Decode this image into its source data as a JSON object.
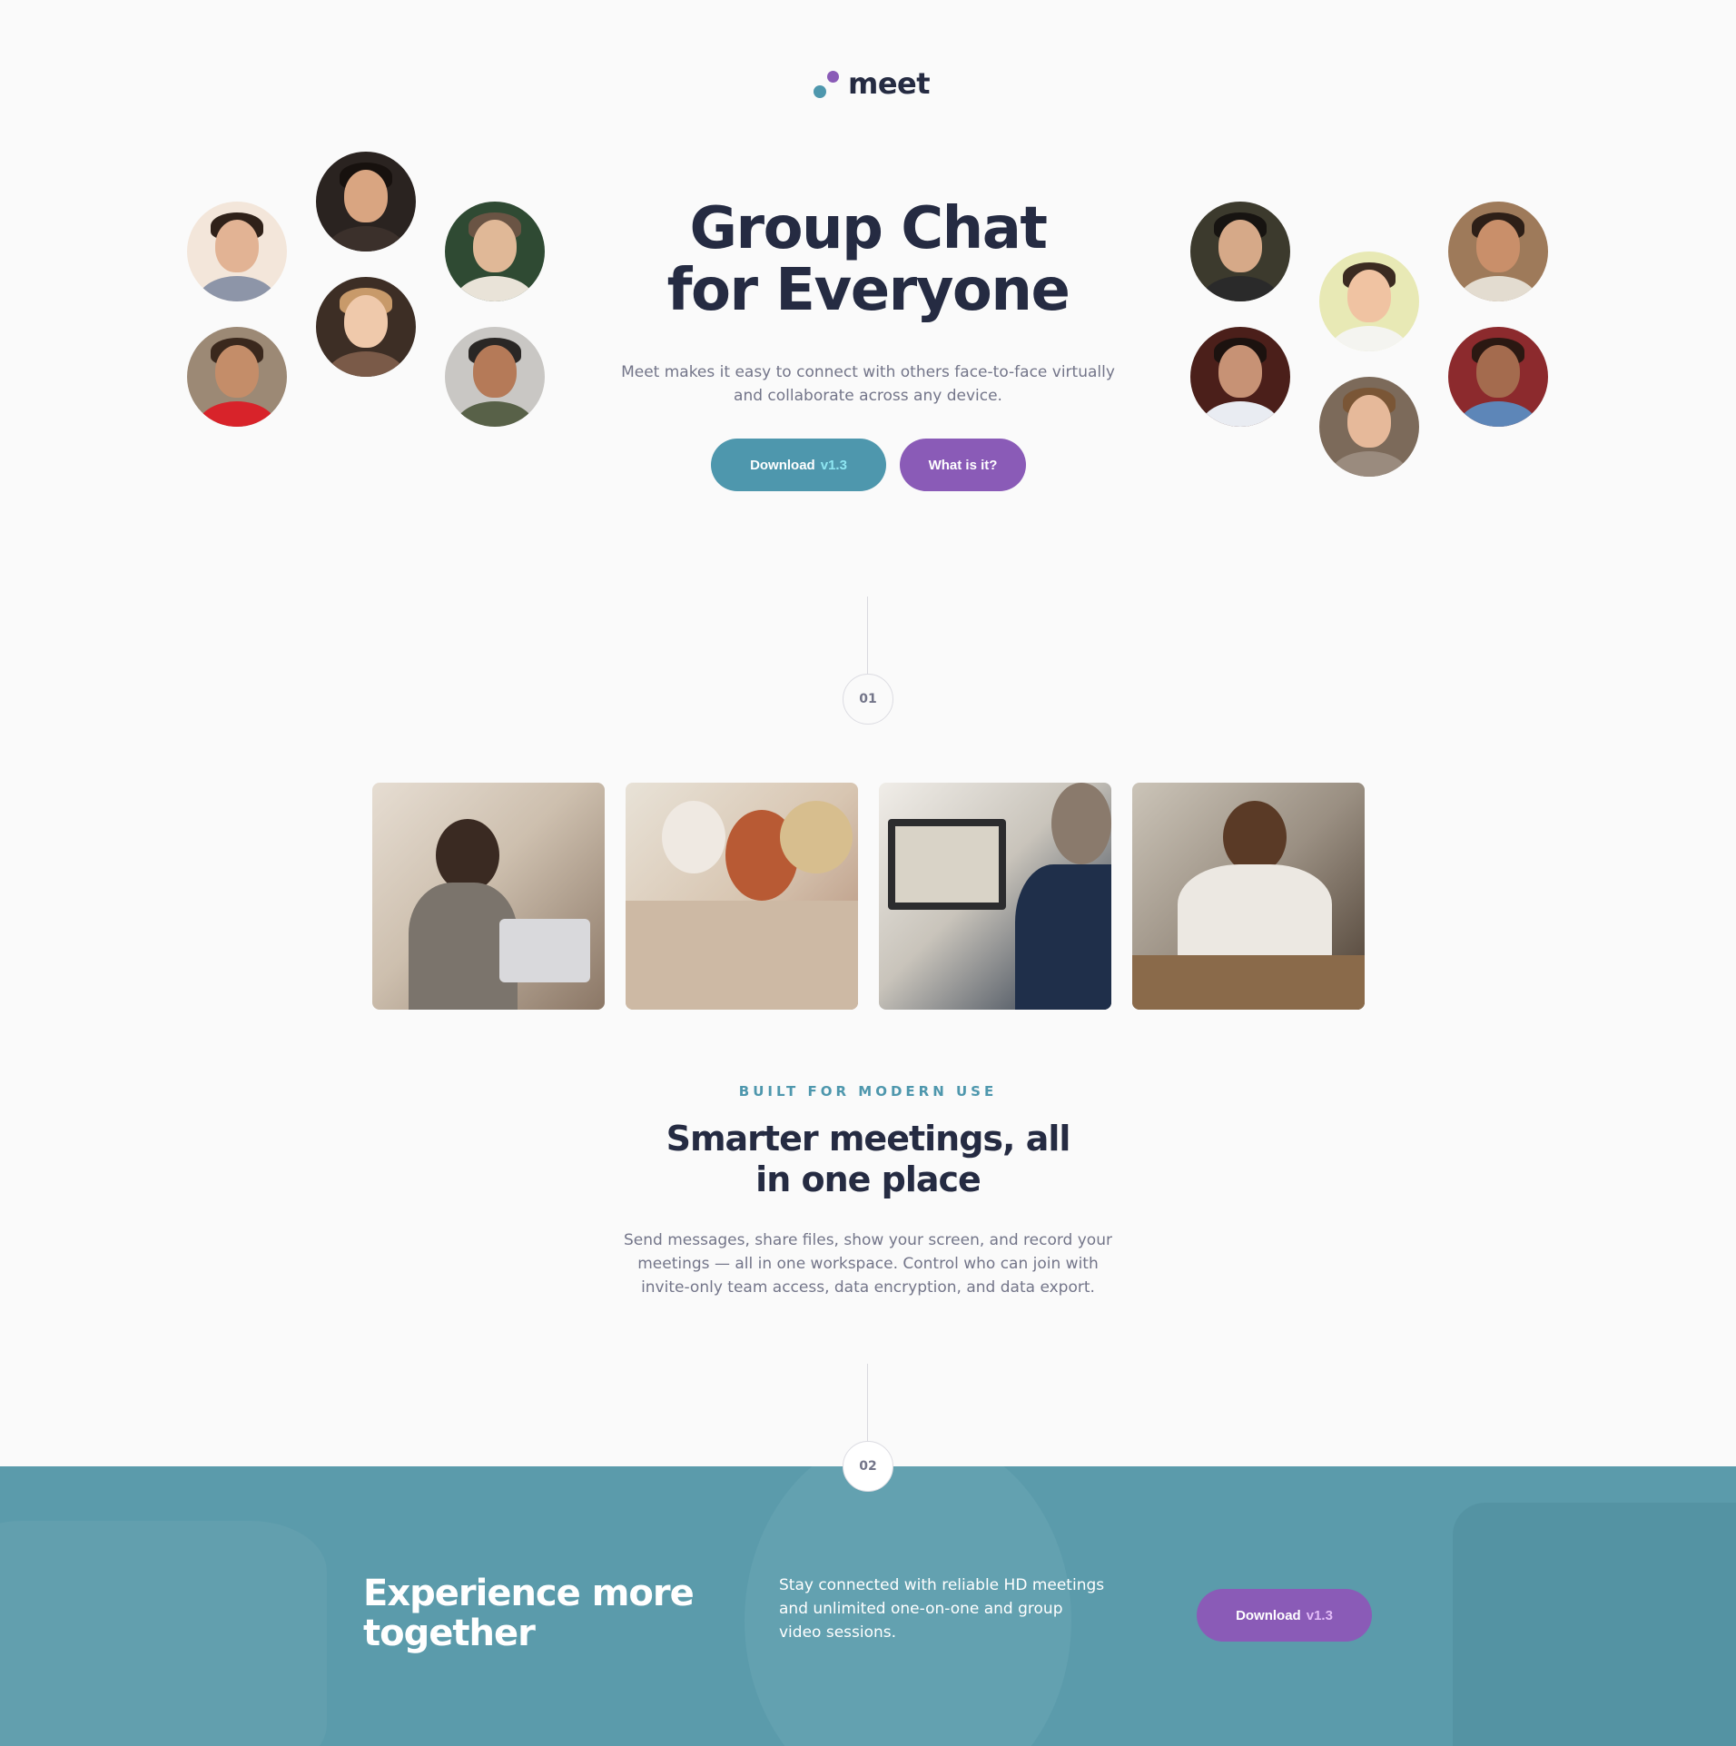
{
  "brand": {
    "name": "meet",
    "colors": {
      "teal": "#4e97ad",
      "purple": "#8a5bb7",
      "dark": "#252b42"
    }
  },
  "hero": {
    "title_line1": "Group Chat",
    "title_line2": "for Everyone",
    "subtitle": "Meet makes it easy to connect with others face-to-face virtually and collaborate across any device.",
    "download_label": "Download",
    "download_version": "v1.3",
    "whatis_label": "What is it?"
  },
  "steps": {
    "one": "01",
    "two": "02"
  },
  "section1": {
    "eyebrow": "BUILT FOR MODERN USE",
    "title_line1": "Smarter meetings, all",
    "title_line2": "in one place",
    "body": "Send messages, share files, show your screen, and record your meetings — all in one workspace. Control who can join with invite-only team access, data encryption, and data export."
  },
  "cta": {
    "title": "Experience more together",
    "body": "Stay connected with reliable HD meetings and unlimited one-on-one and group video sessions.",
    "download_label": "Download",
    "download_version": "v1.3"
  }
}
